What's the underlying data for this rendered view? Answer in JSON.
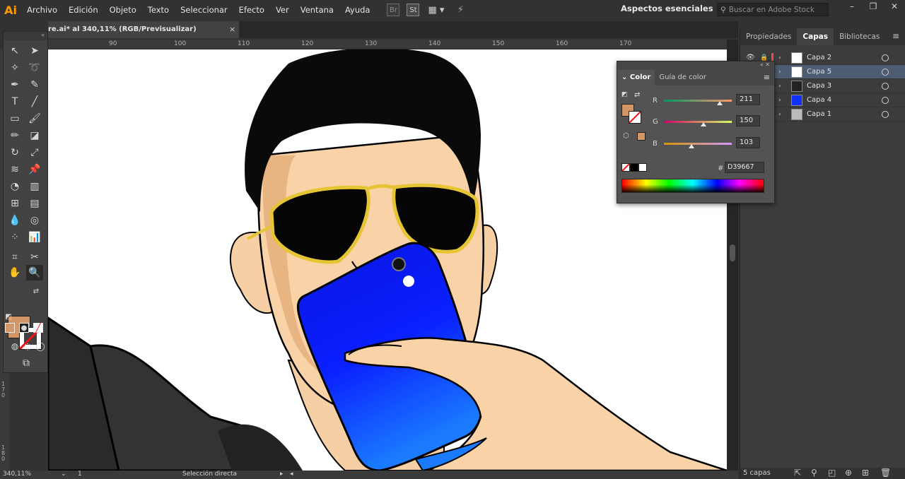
{
  "app": {
    "logo": "Ai",
    "menu": [
      "Archivo",
      "Edición",
      "Objeto",
      "Texto",
      "Seleccionar",
      "Efecto",
      "Ver",
      "Ventana",
      "Ayuda"
    ],
    "bridge_label": "Br",
    "stock_label": "St",
    "workspace": "Aspectos esenciales",
    "search_placeholder": "Buscar en Adobe Stock"
  },
  "document": {
    "tab_title": "re.ai* al 340,11% (RGB/Previsualizar)",
    "close": "×",
    "ruler_marks": [
      "90",
      "100",
      "110",
      "120",
      "130",
      "140",
      "150",
      "160",
      "170"
    ],
    "vruler_marks": [
      "170",
      "180"
    ]
  },
  "status": {
    "zoom": "340,11%",
    "artboard": "1",
    "tool": "Selección directa"
  },
  "dock": {
    "tabs": [
      "Propiedades",
      "Capas",
      "Bibliotecas"
    ],
    "active_tab": "Capas",
    "layers": [
      {
        "name": "Capa 2",
        "color": "#f04b4b"
      },
      {
        "name": "Capa 5",
        "color": "#4b6cf0",
        "selected": true
      },
      {
        "name": "Capa 3",
        "color": "#4bd04b"
      },
      {
        "name": "Capa 4",
        "color": "#3b3bff"
      },
      {
        "name": "Capa 1",
        "color": "#4b8cf0"
      }
    ],
    "layer_count": "5 capas"
  },
  "color_panel": {
    "tabs": [
      "Color",
      "Guía de color"
    ],
    "channels": [
      {
        "label": "R",
        "value": "211",
        "fraction": 0.827
      },
      {
        "label": "G",
        "value": "150",
        "fraction": 0.588
      },
      {
        "label": "B",
        "value": "103",
        "fraction": 0.404
      }
    ],
    "hex_label": "#",
    "hex": "D39667"
  },
  "colors": {
    "fill": "#d39667",
    "accent": "#ff9a00"
  }
}
